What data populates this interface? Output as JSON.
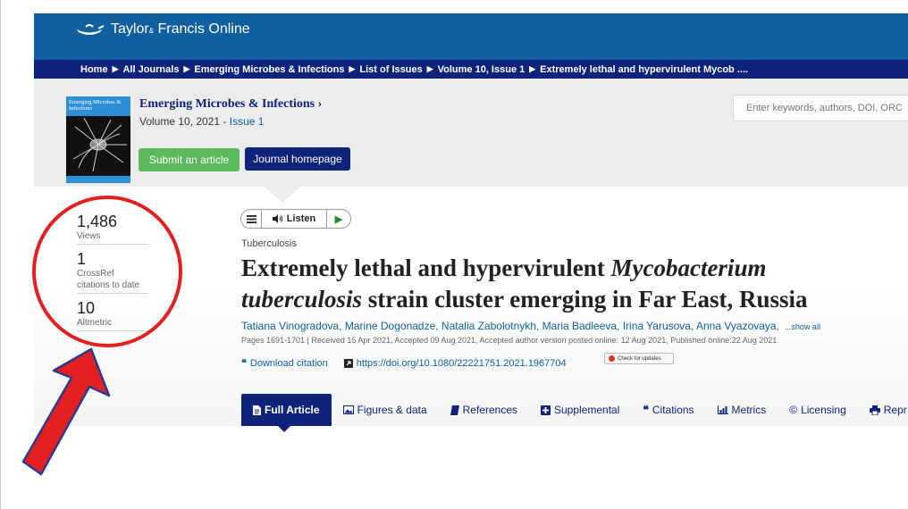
{
  "header": {
    "logo_main": "Taylor",
    "logo_amp": "&",
    "logo_rest": "Francis Online"
  },
  "breadcrumb": [
    "Home",
    "All Journals",
    "Emerging Microbes & Infections",
    "List of Issues",
    "Volume 10, Issue 1",
    "Extremely lethal and hypervirulent Mycob ...."
  ],
  "journal": {
    "title": "Emerging Microbes & Infections ›",
    "volume": "Volume 10, 2021 - ",
    "issue": "Issue 1",
    "cover_title": "Emerging Microbes & Infections",
    "submit_label": "Submit an article",
    "homepage_label": "Journal homepage"
  },
  "search": {
    "placeholder": "Enter keywords, authors, DOI, ORC"
  },
  "metrics": [
    {
      "value": "1,486",
      "label": "Views"
    },
    {
      "value": "1",
      "label": "CrossRef citations to date"
    },
    {
      "value": "10",
      "label": "Altmetric"
    }
  ],
  "listen": {
    "label": "Listen"
  },
  "article": {
    "subject": "Tuberculosis",
    "title_part1": "Extremely lethal and hypervirulent ",
    "title_italic1": "Mycobacterium",
    "title_italic2": "tuberculosis",
    "title_part2": " strain cluster emerging in Far East, Russia",
    "authors": "Tatiana Vinogradova, Marine Dogonadze, Natalia Zabolotnykh, Maria Badleeva, Irina Yarusova, Anna Vyazovaya,",
    "show_all": "...show all",
    "pub_info": "Pages 1691-1701 | Received 15 Apr 2021, Accepted 09 Aug 2021, Accepted author version posted online: 12 Aug 2021, Published online:22 Aug 2021",
    "download_citation": "Download citation",
    "doi": "https://doi.org/10.1080/22221751.2021.1967704",
    "check_updates": "Check for updates"
  },
  "tabs": [
    {
      "label": "Full Article",
      "icon": "document-icon"
    },
    {
      "label": "Figures & data",
      "icon": "image-icon"
    },
    {
      "label": "References",
      "icon": "book-icon"
    },
    {
      "label": "Supplemental",
      "icon": "plus-box-icon"
    },
    {
      "label": "Citations",
      "icon": "quote-icon"
    },
    {
      "label": "Metrics",
      "icon": "bar-chart-icon"
    },
    {
      "label": "Licensing",
      "icon": "copyright-icon"
    },
    {
      "label": "Repr",
      "icon": "print-icon"
    }
  ],
  "colors": {
    "header_blue": "#10609f",
    "navy": "#10237a",
    "submit_green": "#5cb85c",
    "annotation_red": "#e41f1f"
  }
}
